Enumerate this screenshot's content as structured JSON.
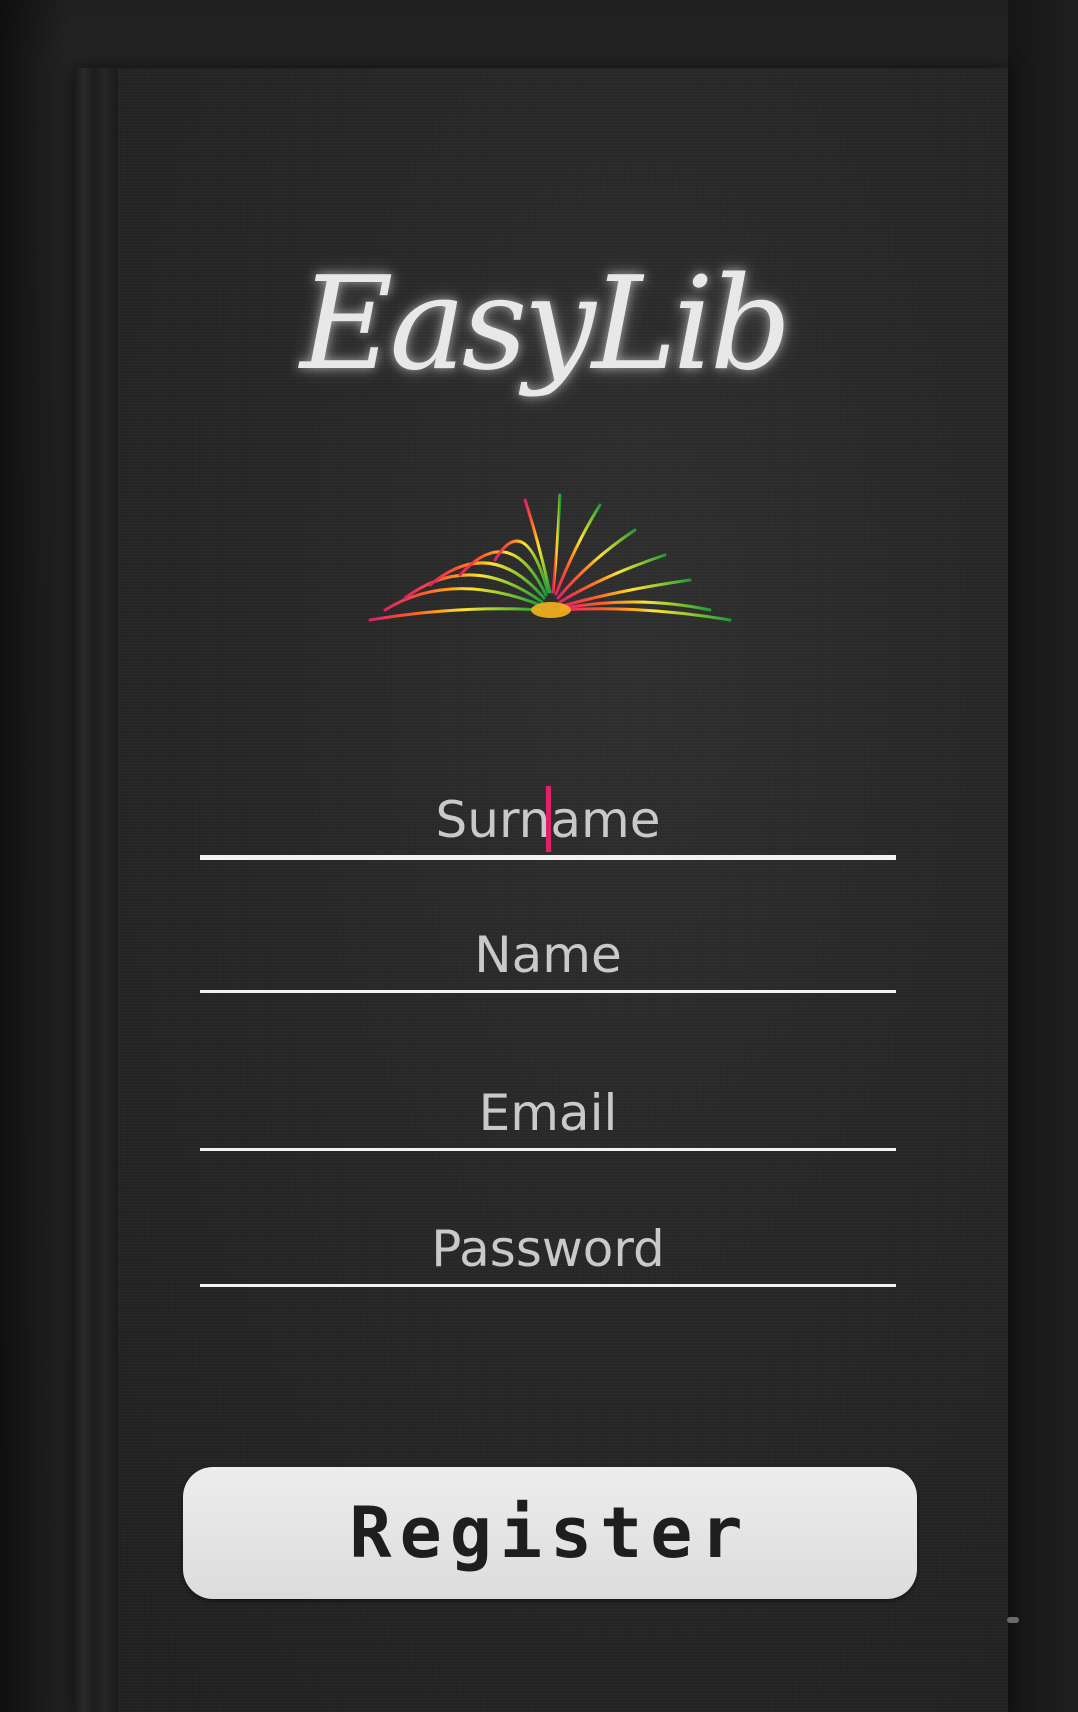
{
  "app": {
    "logo_text": "EasyLib",
    "logo_icon": "open-book-icon"
  },
  "form": {
    "surname": {
      "placeholder": "Surname",
      "value": ""
    },
    "name": {
      "placeholder": "Name",
      "value": ""
    },
    "email": {
      "placeholder": "Email",
      "value": ""
    },
    "password": {
      "placeholder": "Password",
      "value": ""
    }
  },
  "actions": {
    "register_label": "Register"
  },
  "colors": {
    "background": "#222222",
    "accent_caret": "#e0206a",
    "button_bg": "#e6e6e6",
    "text": "#d6d6d6"
  }
}
